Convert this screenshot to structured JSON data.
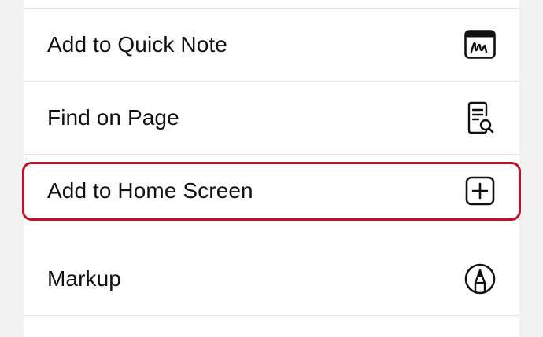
{
  "menu": {
    "items": [
      {
        "label": "Add to Quick Note",
        "icon": "quick-note-icon"
      },
      {
        "label": "Find on Page",
        "icon": "find-on-page-icon"
      },
      {
        "label": "Add to Home Screen",
        "icon": "add-square-icon"
      },
      {
        "label": "Markup",
        "icon": "markup-icon"
      }
    ]
  },
  "highlight": {
    "target": "Add to Home Screen",
    "color": "#c0102a"
  },
  "colors": {
    "background": "#f2f2f2",
    "card": "#ffffff",
    "text": "#111111"
  }
}
